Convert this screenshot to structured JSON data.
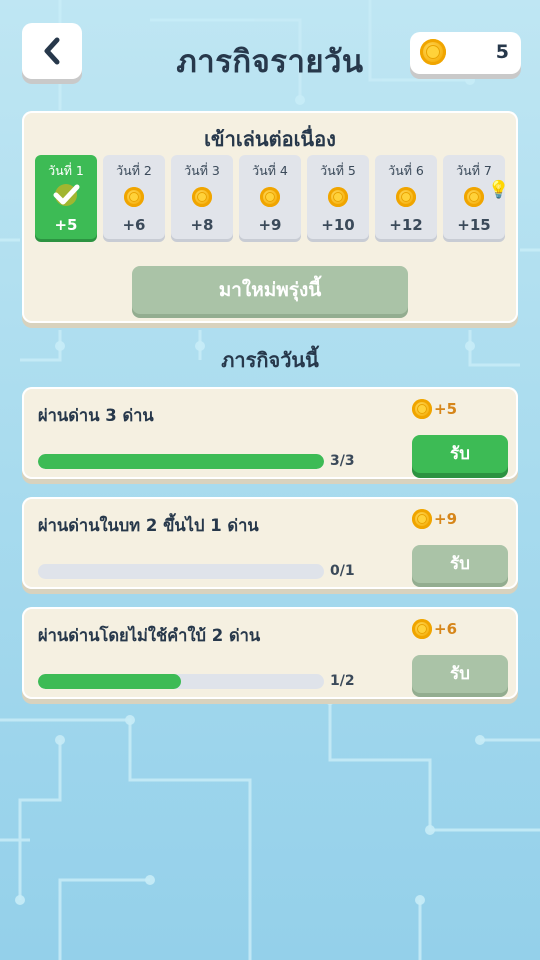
{
  "header": {
    "title": "ภารกิจรายวัน",
    "coins": "5"
  },
  "streak": {
    "title": "เข้าเล่นต่อเนื่อง",
    "days": [
      {
        "label": "วันที่ 1",
        "reward": "+5",
        "claimed": true
      },
      {
        "label": "วันที่ 2",
        "reward": "+6",
        "claimed": false
      },
      {
        "label": "วันที่ 3",
        "reward": "+8",
        "claimed": false
      },
      {
        "label": "วันที่ 4",
        "reward": "+9",
        "claimed": false
      },
      {
        "label": "วันที่ 5",
        "reward": "+10",
        "claimed": false
      },
      {
        "label": "วันที่ 6",
        "reward": "+12",
        "claimed": false
      },
      {
        "label": "วันที่ 7",
        "reward": "+15",
        "claimed": false
      }
    ],
    "button_label": "มาใหม่พรุ่งนี้"
  },
  "today": {
    "title": "ภารกิจวันนี้",
    "tasks": [
      {
        "name": "ผ่านด่าน 3 ด่าน",
        "reward": "+5",
        "progress_text": "3/3",
        "progress_fraction": 1.0,
        "button_label": "รับ",
        "button_enabled": true
      },
      {
        "name": "ผ่านด่านในบท 2 ขึ้นไป 1 ด่าน",
        "reward": "+9",
        "progress_text": "0/1",
        "progress_fraction": 0.0,
        "button_label": "รับ",
        "button_enabled": false
      },
      {
        "name": "ผ่านด่านโดยไม่ใช้คำใบ้ 2 ด่าน",
        "reward": "+6",
        "progress_text": "1/2",
        "progress_fraction": 0.5,
        "button_label": "รับ",
        "button_enabled": false
      }
    ]
  },
  "colors": {
    "accent_green": "#3dbb55",
    "disabled_green": "#aac3a7",
    "reward_orange": "#d6861a"
  }
}
